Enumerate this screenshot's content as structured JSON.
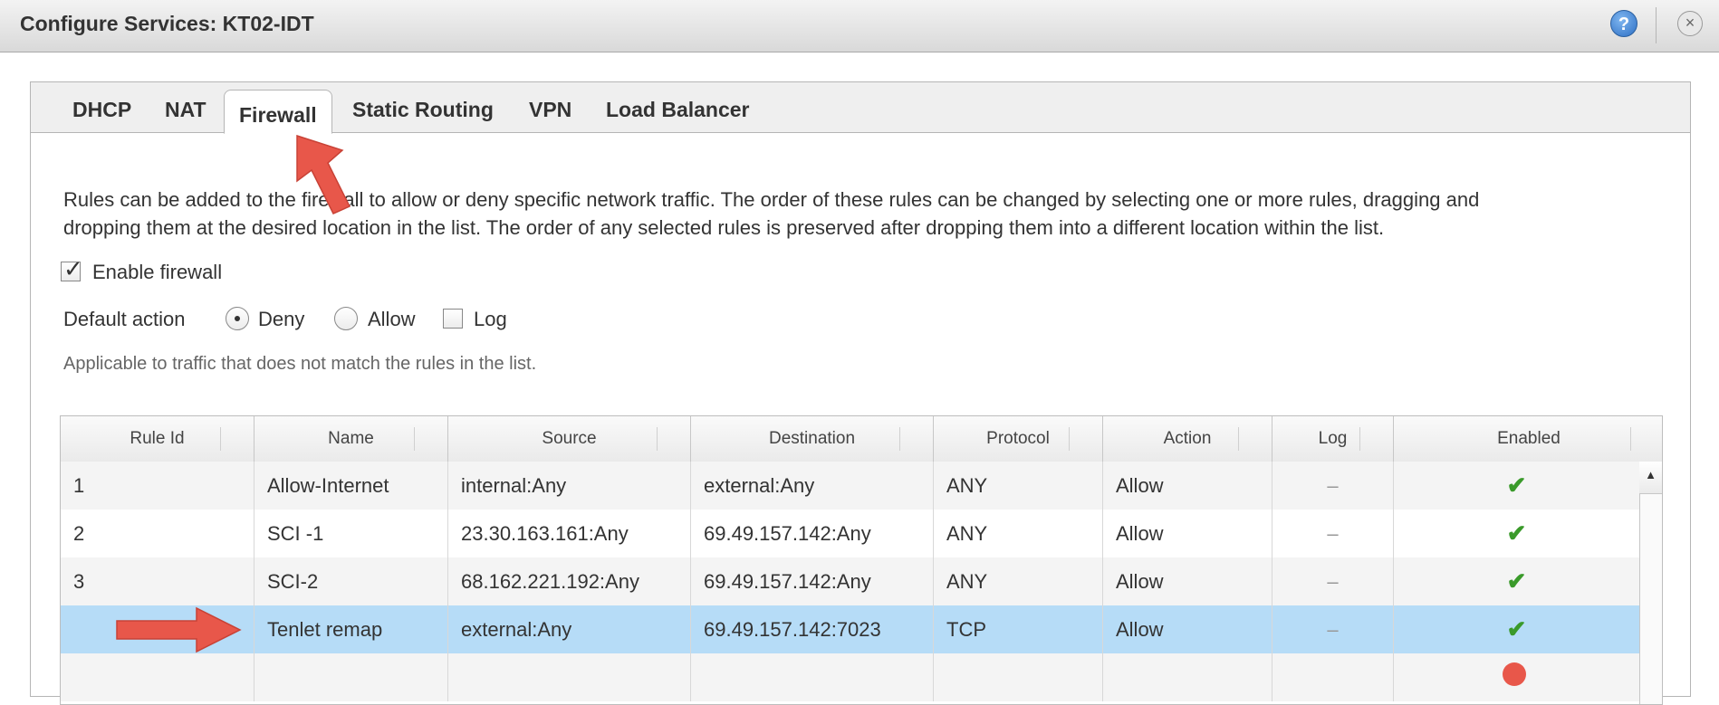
{
  "window": {
    "title": "Configure Services: KT02-IDT",
    "help_icon": "?",
    "close_icon": "×"
  },
  "tabs": [
    {
      "label": "DHCP",
      "active": false
    },
    {
      "label": "NAT",
      "active": false
    },
    {
      "label": "Firewall",
      "active": true
    },
    {
      "label": "Static Routing",
      "active": false
    },
    {
      "label": "VPN",
      "active": false
    },
    {
      "label": "Load Balancer",
      "active": false
    }
  ],
  "description_line1": "Rules can be added to the firewall to allow or deny specific network traffic. The order of these rules can be changed by selecting one or more rules, dragging and",
  "description_line2": "dropping them at the desired location in the list. The order of any selected rules is preserved after dropping them into a different location within the list.",
  "enable_firewall": {
    "label": "Enable firewall",
    "checked": true
  },
  "default_action": {
    "label": "Default action",
    "options": [
      {
        "label": "Deny",
        "selected": true
      },
      {
        "label": "Allow",
        "selected": false
      }
    ],
    "log_label": "Log",
    "log_checked": false
  },
  "hint": "Applicable to traffic that does not match the rules in the list.",
  "table": {
    "columns": [
      "Rule Id",
      "Name",
      "Source",
      "Destination",
      "Protocol",
      "Action",
      "Log",
      "Enabled"
    ],
    "rows": [
      {
        "id": "1",
        "name": "Allow-Internet",
        "source": "internal:Any",
        "destination": "external:Any",
        "protocol": "ANY",
        "action": "Allow",
        "log": "–",
        "enabled": "✔"
      },
      {
        "id": "2",
        "name": "SCI -1",
        "source": "23.30.163.161:Any",
        "destination": "69.49.157.142:Any",
        "protocol": "ANY",
        "action": "Allow",
        "log": "–",
        "enabled": "✔"
      },
      {
        "id": "3",
        "name": "SCI-2",
        "source": "68.162.221.192:Any",
        "destination": "69.49.157.142:Any",
        "protocol": "ANY",
        "action": "Allow",
        "log": "–",
        "enabled": "✔"
      },
      {
        "id": "",
        "name": "Tenlet remap",
        "source": "external:Any",
        "destination": "69.49.157.142:7023",
        "protocol": "TCP",
        "action": "Allow",
        "log": "–",
        "enabled": "✔"
      }
    ]
  },
  "annotation_color": "#e8574a"
}
